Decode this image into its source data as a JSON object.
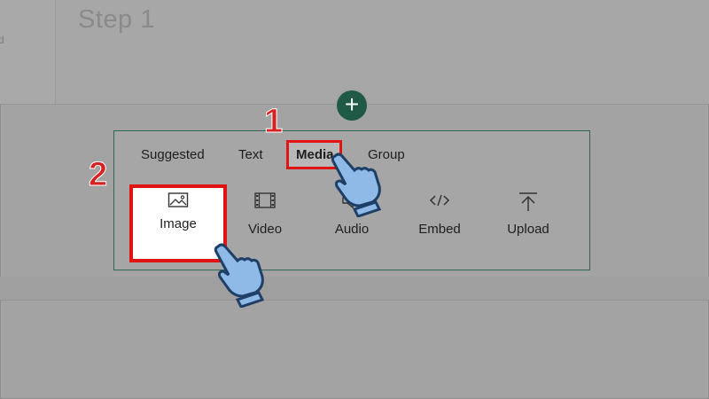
{
  "page": {
    "step_title": "Step 1",
    "left_stub": "d"
  },
  "insert_button": {
    "glyph": "+"
  },
  "tabs": [
    {
      "label": "Suggested"
    },
    {
      "label": "Text"
    },
    {
      "label": "Media"
    },
    {
      "label": "Group"
    }
  ],
  "active_tab": "Media",
  "media_items": [
    {
      "label": "Image",
      "icon": "image-icon"
    },
    {
      "label": "Video",
      "icon": "film-icon"
    },
    {
      "label": "Audio",
      "icon": "speaker-icon"
    },
    {
      "label": "Embed",
      "icon": "code-icon"
    },
    {
      "label": "Upload",
      "icon": "upload-icon"
    }
  ],
  "callouts": {
    "step1": "1",
    "step2": "2"
  },
  "colors": {
    "accent_green": "#1f5a46",
    "highlight_red": "#e01414",
    "hand_blue": "#8fb9e6"
  }
}
